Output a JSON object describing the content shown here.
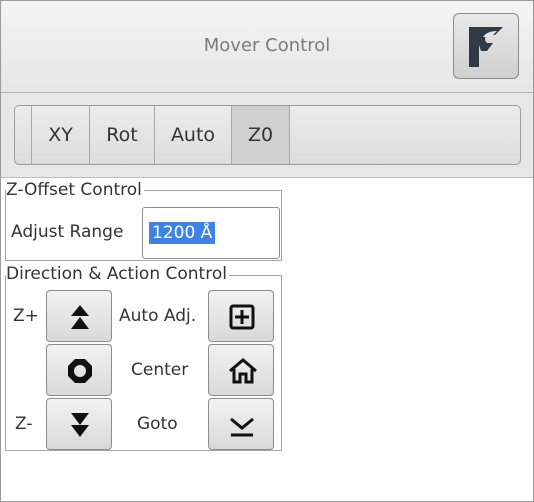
{
  "window": {
    "title": "Mover Control"
  },
  "tabs": [
    {
      "label": "XY",
      "active": false
    },
    {
      "label": "Rot",
      "active": false
    },
    {
      "label": "Auto",
      "active": false
    },
    {
      "label": "Z0",
      "active": true
    }
  ],
  "zoffset": {
    "title": "Z-Offset Control",
    "adjust_label": "Adjust Range",
    "adjust_value": "1200 Å"
  },
  "direction": {
    "title": "Direction & Action Control",
    "zplus_label": "Z+",
    "zminus_label": "Z-",
    "auto_adj_label": "Auto Adj.",
    "center_label": "Center",
    "goto_label": "Goto",
    "icons": [
      "double-up-arrow-icon",
      "octagon-stop-icon",
      "double-down-arrow-icon",
      "grid-plus-icon",
      "home-icon",
      "down-to-line-icon"
    ]
  },
  "colors": {
    "selection": "#3d83e6",
    "title_text": "#7b7b7b"
  }
}
